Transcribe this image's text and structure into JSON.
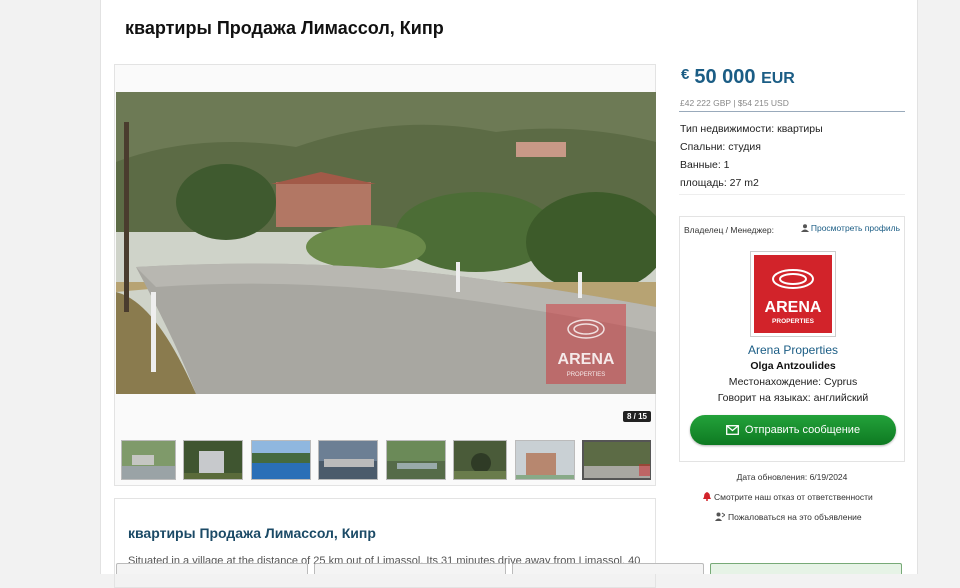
{
  "listing": {
    "title": "квартиры Продажа Лимассол, Кипр"
  },
  "gallery": {
    "counter": "8 / 15",
    "thumb_count": 8,
    "next_glyph": "›",
    "watermark_brand": "ARENA",
    "watermark_sub": "PROPERTIES"
  },
  "price": {
    "currency_symbol": "€",
    "amount": "50 000",
    "currency": "EUR",
    "alt": "£42 222 GBP | $54 215 USD"
  },
  "facts": {
    "type": "Тип недвижимости: квартиры",
    "bedrooms": "Спальни: студия",
    "bathrooms": "Ванные: 1",
    "area": "площадь: 27 m2"
  },
  "owner": {
    "label": "Владелец / Менеджер:",
    "profile_link": "Просмотреть профиль",
    "logo_brand": "ARENA",
    "logo_sub": "PROPERTIES",
    "agency": "Arena Properties",
    "agent": "Olga Antzoulides",
    "location": "Местонахождение: Cyprus",
    "languages": "Говорит на языках: английский",
    "send_button": "Отправить сообщение"
  },
  "meta": {
    "updated": "Дата обновления: 6/19/2024",
    "disclaimer": "Смотрите наш отказ от ответственности",
    "report": "Пожаловаться на это объявление"
  },
  "description": {
    "title": "квартиры Продажа Лимассол, Кипр",
    "text": "Situated in a village at the distance of 25 km out of Limassol. Its 31 minutes drive away from Limassol. 40"
  },
  "colors": {
    "accent": "#1b5d85",
    "brand_red": "#d2232a",
    "button_green": "#0e7a22"
  },
  "icons": {
    "person": "person-icon",
    "alert": "alert-icon",
    "report": "report-icon",
    "mail": "mail-icon"
  }
}
